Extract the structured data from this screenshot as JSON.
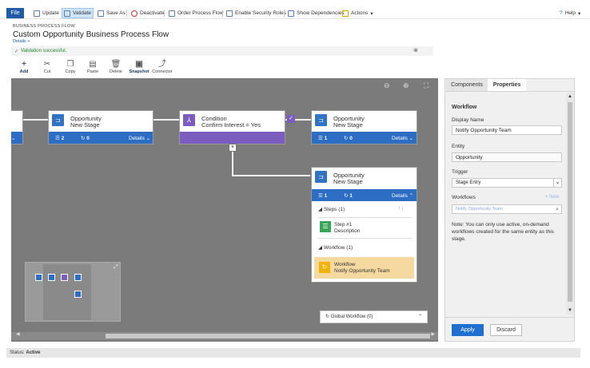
{
  "toolbar": {
    "file": "File",
    "update": "Update",
    "validate": "Validate",
    "save_as": "Save As",
    "deactivate": "Deactivate",
    "order_process_flow": "Order Process Flow",
    "enable_security_roles": "Enable Security Roles",
    "show_dependencies": "Show Dependencies",
    "actions": "Actions",
    "help": "Help"
  },
  "header": {
    "entity_type": "BUSINESS PROCESS FLOW",
    "title": "Custom Opportunity Business Process Flow",
    "details": "Details"
  },
  "validation": {
    "message": "Validation successful."
  },
  "commands": [
    "Add",
    "Cut",
    "Copy",
    "Paste",
    "Delete",
    "Snapshot",
    "Connector"
  ],
  "canvas": {
    "nodes": {
      "stage1": {
        "title": "Opportunity",
        "subtitle": "New Stage",
        "steps": "2",
        "workflows": "0",
        "details": "Details"
      },
      "condition": {
        "title": "Condition",
        "subtitle": "Confirm Interest = Yes"
      },
      "stage2": {
        "title": "Opportunity",
        "subtitle": "New Stage",
        "steps": "1",
        "workflows": "0",
        "details": "Details"
      },
      "stage3": {
        "title": "Opportunity",
        "subtitle": "New Stage",
        "steps": "1",
        "workflows": "1",
        "details": "Details"
      }
    },
    "expanded": {
      "steps_header": "Steps (1)",
      "step_title": "Step #1",
      "step_desc": "Description",
      "workflow_header": "Workflow (1)",
      "workflow_title": "Workflow",
      "workflow_name": "Notify Opportunity Team"
    },
    "global_workflow": "Global Workflow (0)"
  },
  "panel": {
    "tabs": [
      "Components",
      "Properties"
    ],
    "section": "Workflow",
    "display_name_label": "Display Name",
    "display_name_value": "Notify Opportunity Team",
    "entity_label": "Entity",
    "entity_value": "Opportunity",
    "trigger_label": "Trigger",
    "trigger_value": "Stage Entry",
    "workflows_label": "Workflows",
    "new_link": "+ New",
    "workflows_placeholder": "Notify Opportunity Team",
    "note": "Note: You can only use active, on-demand workflows created for the same entity as this stage.",
    "apply": "Apply",
    "discard": "Discard"
  },
  "status": {
    "label": "Status:",
    "value": "Active"
  },
  "colors": {
    "stage_blue": "#2d6ec4",
    "condition_purple": "#7b5cbf",
    "workflow_yellow": "#f5d9a0",
    "step_green": "#3aa65a"
  }
}
